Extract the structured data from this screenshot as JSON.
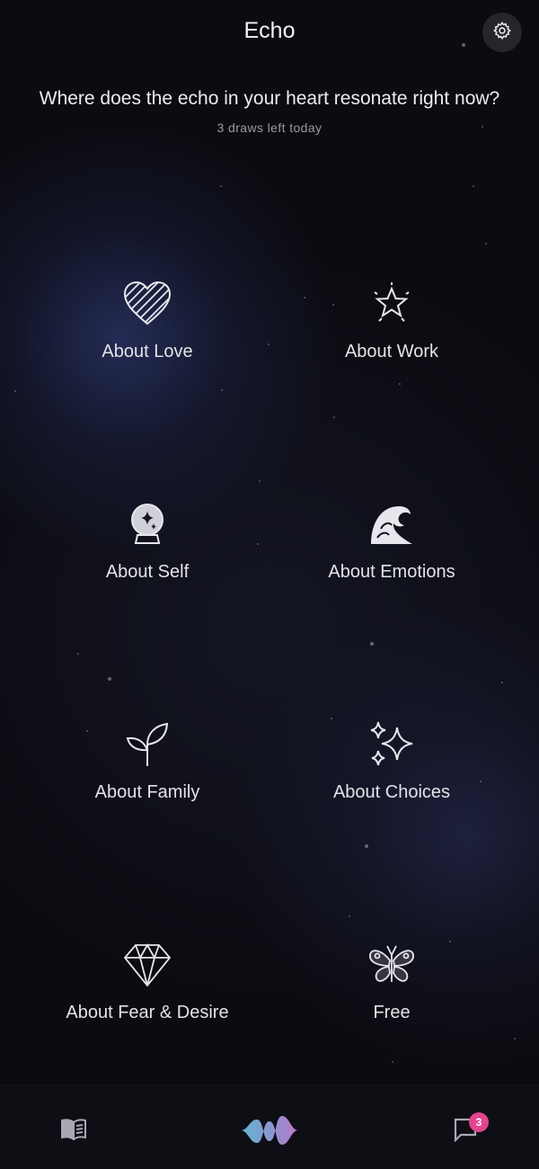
{
  "header": {
    "title": "Echo",
    "settings_icon": "gear-icon"
  },
  "prompt": {
    "question": "Where does the echo in your heart resonate right now?",
    "draws_left": "3 draws left today"
  },
  "topics": [
    {
      "label": "About Love",
      "icon": "heart-icon"
    },
    {
      "label": "About Work",
      "icon": "star-icon"
    },
    {
      "label": "About Self",
      "icon": "crystal-ball-icon"
    },
    {
      "label": "About Emotions",
      "icon": "wave-icon"
    },
    {
      "label": "About Family",
      "icon": "sprout-icon"
    },
    {
      "label": "About Choices",
      "icon": "sparkles-icon"
    },
    {
      "label": "About Fear & Desire",
      "icon": "diamond-icon"
    },
    {
      "label": "Free",
      "icon": "butterfly-icon"
    }
  ],
  "nav": {
    "journal_icon": "book-icon",
    "echo_icon": "sound-wave-icon",
    "messages_icon": "chat-icon",
    "messages_badge": "3"
  },
  "colors": {
    "background": "#0b0b10",
    "badge": "#e2468f",
    "accent_wave_start": "#6fd3f5",
    "accent_wave_end": "#d88ae8"
  }
}
